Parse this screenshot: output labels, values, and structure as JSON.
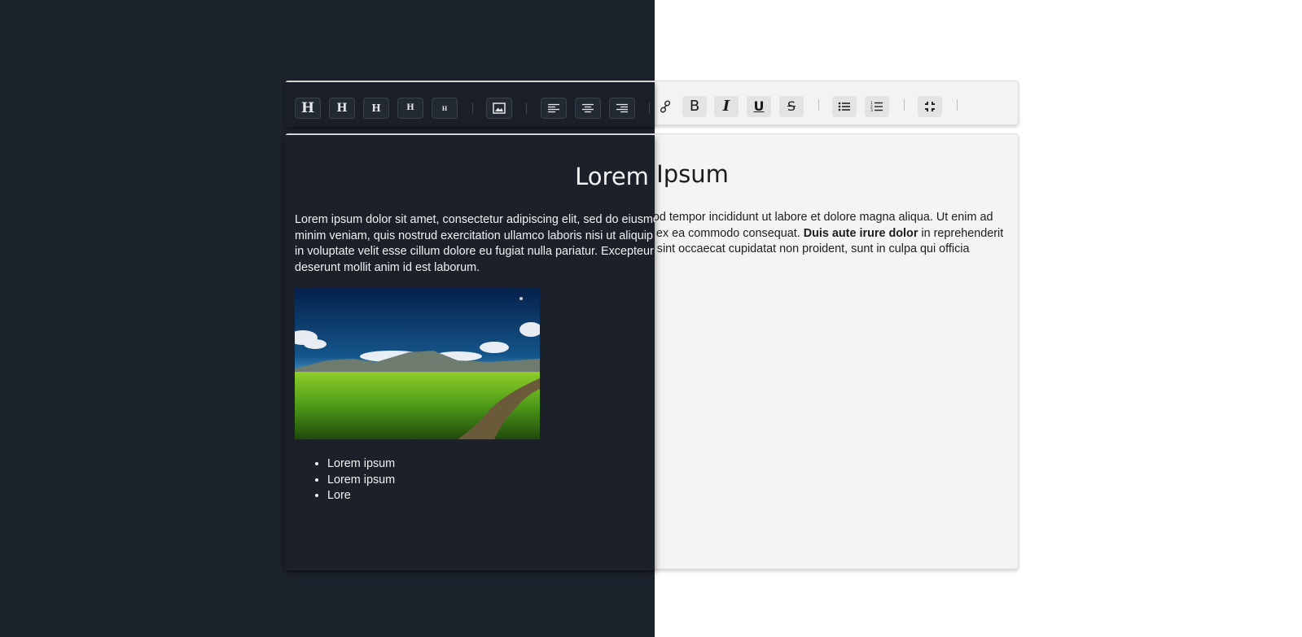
{
  "toolbar": {
    "heading_buttons": [
      "H",
      "H",
      "H",
      "H",
      "H"
    ],
    "insert_image_icon": "image-icon",
    "align_icons": [
      "align-left-icon",
      "align-center-icon",
      "align-right-icon"
    ],
    "link_icon": "link-icon",
    "format_buttons": [
      "B",
      "I",
      "U",
      "S"
    ],
    "list_icons": [
      "bullet-list-icon",
      "numbered-list-icon"
    ],
    "fullscreen_icon": "exit-fullscreen-icon"
  },
  "document": {
    "title": "Lorem Ipsum",
    "paragraph_start": "Lorem ipsum dolor sit amet, consectetur adipiscing elit, sed do eiusmod tempor incididunt ut labore et dolore magna aliqua. Ut enim ad minim veniam, quis nostrud exercitation ullamco laboris nisi ut aliquip ex ea commodo consequat. ",
    "paragraph_bold": "Duis aute irure dolor",
    "paragraph_end": " in reprehenderit in voluptate velit esse cillum dolore eu fugiat nulla pariatur. Excepteur sint occaecat cupidatat non proident, sunt in culpa qui officia deserunt mollit anim id est laborum.",
    "image": "landscape-photo",
    "list_items": [
      "Lorem ipsum",
      "Lorem ipsum",
      "Lore"
    ]
  },
  "theme": {
    "dark_background": "#1d232d",
    "light_background": "#ffffff"
  }
}
